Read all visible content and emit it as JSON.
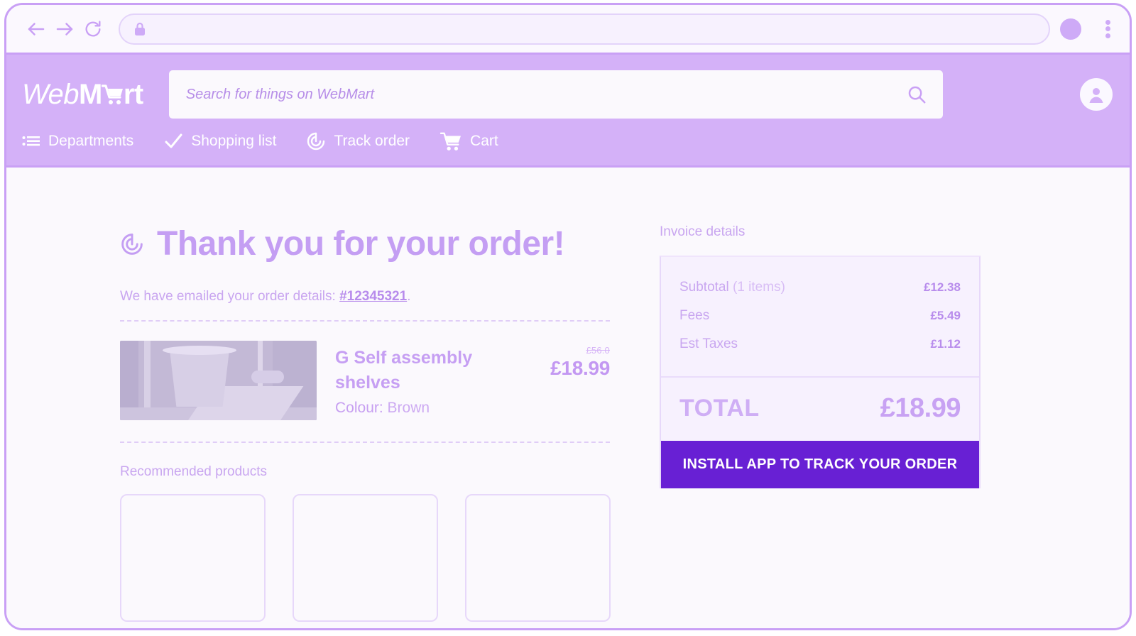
{
  "browser": {
    "back_icon": "back-arrow-icon",
    "forward_icon": "forward-arrow-icon",
    "reload_icon": "reload-icon",
    "lock_icon": "lock-icon",
    "url_value": "",
    "url_placeholder": "",
    "profile_icon": "profile-avatar-icon",
    "menu_icon": "three-dot-menu-icon"
  },
  "header": {
    "logo": {
      "part_web": "Web",
      "part_m": "M",
      "cart_icon": "shopping-cart-icon",
      "part_rt": "rt",
      "full_text": "WebMart"
    },
    "search": {
      "placeholder": "Search for things on WebMart",
      "value": "",
      "icon": "search-icon"
    },
    "account_icon": "account-person-icon",
    "nav": [
      {
        "label": "Departments",
        "icon": "list-menu-icon"
      },
      {
        "label": "Shopping list",
        "icon": "checkmark-icon"
      },
      {
        "label": "Track order",
        "icon": "radar-target-icon"
      },
      {
        "label": "Cart",
        "icon": "shopping-cart-icon"
      }
    ]
  },
  "main": {
    "thanks_icon": "radar-target-icon",
    "thanks_title": "Thank you for your order!",
    "emailed_prefix": "We have emailed your order details: ",
    "order_number": "#12345321",
    "emailed_suffix": ".",
    "product": {
      "image_alt": "product-photo",
      "title": "G Self assembly shelves",
      "variant_label": "Colour:",
      "variant_value": "Brown",
      "price_was": "£56.0",
      "price_now": "£18.99"
    },
    "recommended_title": "Recommended products",
    "recommended_cards": [
      "",
      "",
      ""
    ]
  },
  "invoice": {
    "title": "Invoice details",
    "lines": [
      {
        "label": "Subtotal",
        "sub": " (1 items)",
        "value": "£12.38"
      },
      {
        "label": "Fees",
        "sub": "",
        "value": "£5.49"
      },
      {
        "label": "Est Taxes",
        "sub": "",
        "value": "£1.12"
      }
    ],
    "total_label": "TOTAL",
    "total_value": "£18.99",
    "install_button": "INSTALL APP TO TRACK YOUR ORDER"
  },
  "colors": {
    "brand_purple": "#d4b1f8",
    "accent_violet": "#c49ef3",
    "cta_purple": "#6820d4",
    "page_bg": "#fbf9fd",
    "card_bg": "#f7f1fe",
    "border_lilac": "#c9a0f5"
  }
}
